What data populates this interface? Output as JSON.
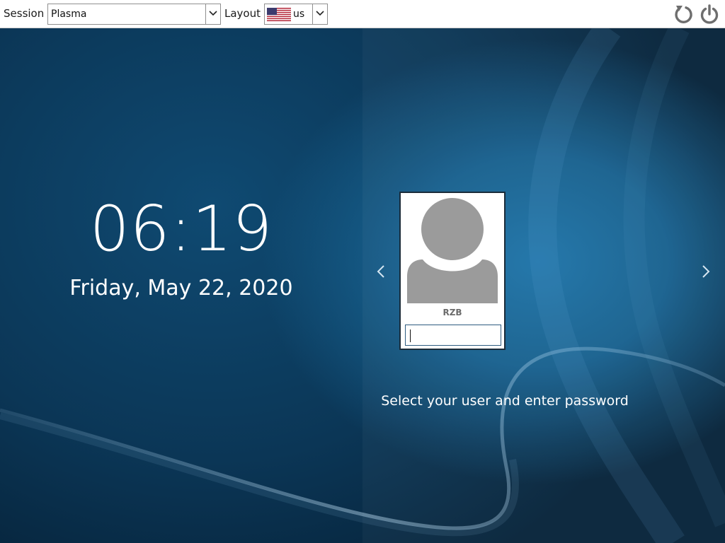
{
  "toolbar": {
    "session_label": "Session",
    "session_value": "Plasma",
    "layout_label": "Layout",
    "layout_value": "us",
    "layout_flag_icon": "us-flag-icon",
    "reboot_icon": "reboot-icon",
    "shutdown_icon": "power-icon"
  },
  "clock": {
    "time": "06:19",
    "date": "Friday, May 22, 2020"
  },
  "user": {
    "name": "RZB",
    "password_value": "",
    "avatar_icon": "user-avatar-icon"
  },
  "navigation": {
    "prev_icon": "chevron-left-icon",
    "next_icon": "chevron-right-icon"
  },
  "hint": "Select your user and enter password",
  "colors": {
    "background": "#0f4a72",
    "accent": "#1d73a8",
    "avatar_gray": "#9b9b9b",
    "icon_gray": "#6e6e6e"
  }
}
